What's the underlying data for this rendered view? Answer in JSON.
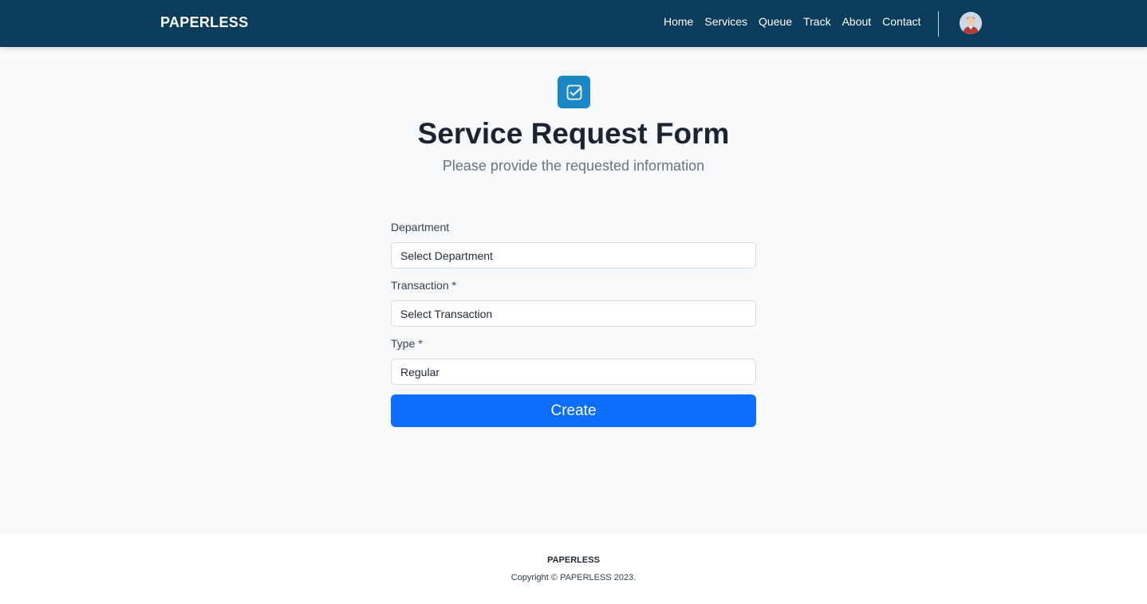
{
  "navbar": {
    "brand": "PAPERLESS",
    "links": [
      "Home",
      "Services",
      "Queue",
      "Track",
      "About",
      "Contact"
    ]
  },
  "header": {
    "icon": "checkbox-icon",
    "title": "Service Request Form",
    "subtitle": "Please provide the requested information"
  },
  "form": {
    "department": {
      "label": "Department",
      "value": "Select Department"
    },
    "transaction": {
      "label": "Transaction *",
      "value": "Select Transaction"
    },
    "type": {
      "label": "Type *",
      "value": "Regular"
    },
    "submit_label": "Create"
  },
  "footer": {
    "brand": "PAPERLESS",
    "copyright": "Copyright © PAPERLESS 2023."
  },
  "colors": {
    "navbar": "#0a3d5c",
    "accent": "#0d6efd",
    "badge": "#1b87c6"
  }
}
